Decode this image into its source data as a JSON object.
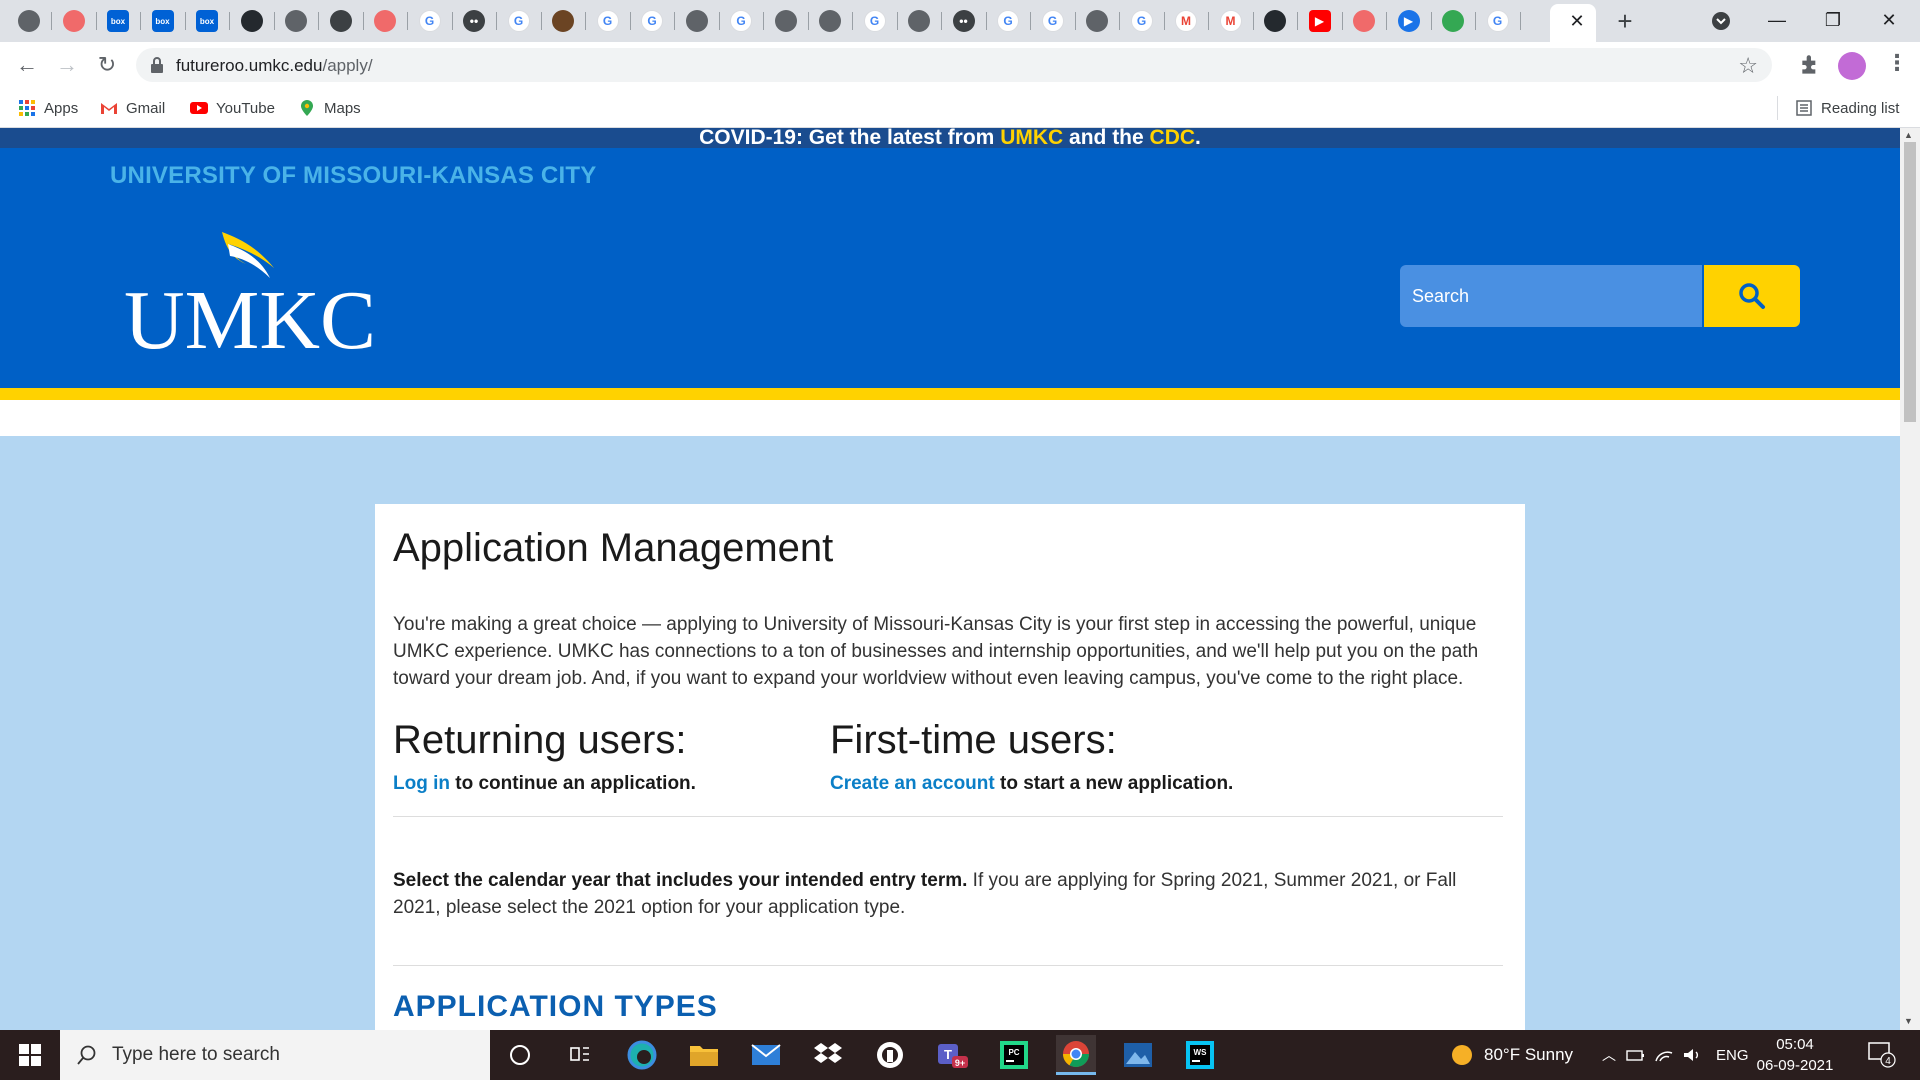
{
  "browser": {
    "url_host": "futureroo.umkc.edu",
    "url_path": "/apply/",
    "bookmarks": [
      {
        "label": "Apps",
        "icon": "apps-grid-icon"
      },
      {
        "label": "Gmail",
        "icon": "gmail-icon"
      },
      {
        "label": "YouTube",
        "icon": "youtube-icon"
      },
      {
        "label": "Maps",
        "icon": "maps-icon"
      }
    ],
    "reading_list": "Reading list"
  },
  "page": {
    "covid_prefix": "COVID-19: Get the latest from ",
    "covid_umkc": "UMKC",
    "covid_and": " and the ",
    "covid_cdc": "CDC",
    "covid_suffix": ".",
    "university_name": "UNIVERSITY OF MISSOURI-KANSAS CITY",
    "logo_text": "UMKC",
    "search_placeholder": "Search",
    "title": "Application Management",
    "intro": "You're making a great choice — applying to University of Missouri-Kansas City is your first step in accessing the powerful, unique UMKC experience. UMKC has connections to a ton of businesses and internship opportunities, and we'll help put you on the path toward your dream job. And, if you want to expand your worldview without even leaving campus, you've come to the right place.",
    "returning": {
      "heading": "Returning users:",
      "link": "Log in",
      "rest": " to continue an application."
    },
    "first_time": {
      "heading": "First-time users:",
      "link": "Create an account",
      "rest": " to start a new application."
    },
    "year_note_bold": "Select the calendar year that includes your intended entry term.",
    "year_note_rest": " If you are applying for Spring 2021, Summer 2021, or Fall 2021, please select the 2021 option for your application type.",
    "application_types": "APPLICATION TYPES"
  },
  "colors": {
    "header_blue": "#0060c6",
    "gold": "#ffd200",
    "link_blue": "#0b7fc7",
    "page_bg": "#b3d6f2"
  },
  "taskbar": {
    "search_placeholder": "Type here to search",
    "weather": "80°F  Sunny",
    "language": "ENG",
    "time": "05:04",
    "date": "06-09-2021",
    "notification_count": "4",
    "teams_badge": "9+"
  }
}
